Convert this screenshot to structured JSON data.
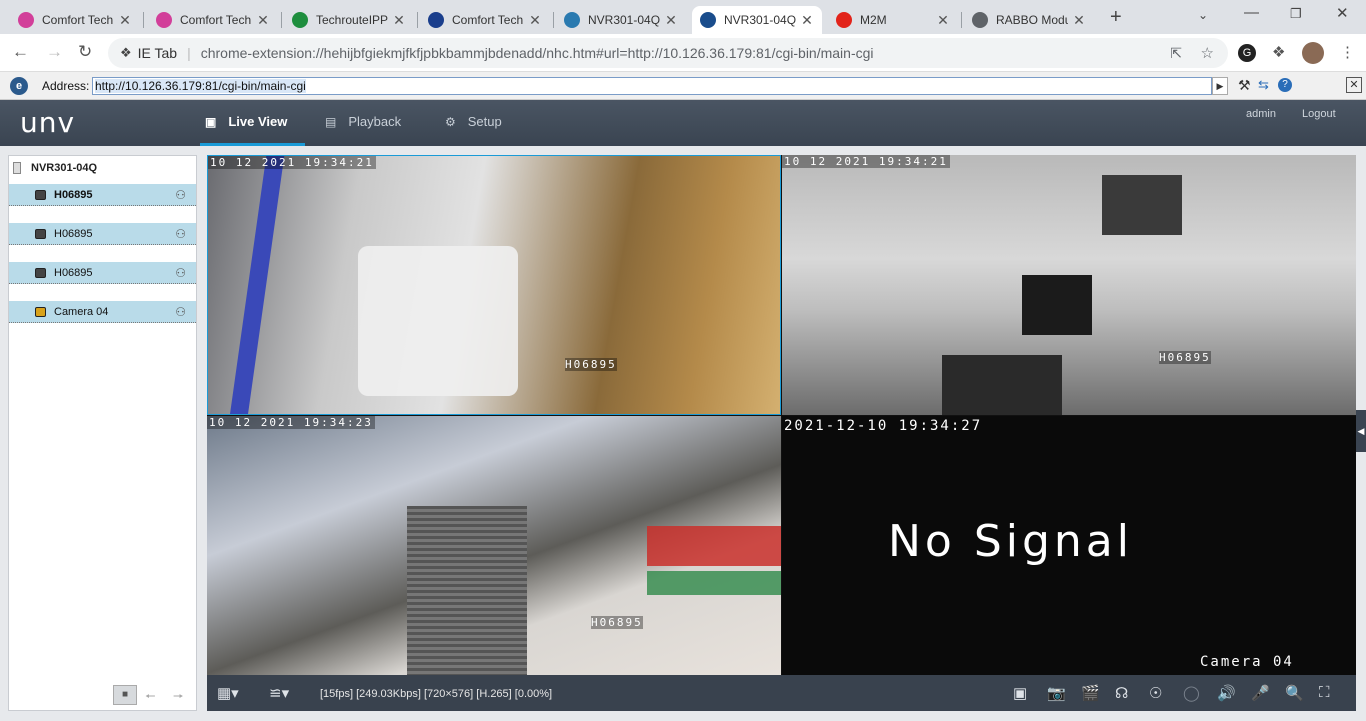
{
  "tabs": [
    {
      "title": "Comfort Tech",
      "icon": "comfort-tech-icon",
      "color": "#d23f9a"
    },
    {
      "title": "Comfort Tech",
      "icon": "comfort-tech-icon",
      "color": "#d23f9a"
    },
    {
      "title": "TechrouteIPP",
      "icon": "sheets-icon",
      "color": "#1e8e3e"
    },
    {
      "title": "Comfort Tech",
      "icon": "comfort-tech-logo-icon",
      "color": "#1a3e8c"
    },
    {
      "title": "NVR301-04Q",
      "icon": "nvr-icon",
      "color": "#2a7ab0"
    },
    {
      "title": "NVR301-04Q",
      "icon": "ie-tab-icon",
      "color": "#1a4d8c"
    },
    {
      "title": "M2M",
      "icon": "airtel-icon",
      "color": "#e2231a"
    },
    {
      "title": "RABBO Modu",
      "icon": "globe-icon",
      "color": "#5f6368"
    }
  ],
  "browser": {
    "ietab_label": "IE Tab",
    "url": "chrome-extension://hehijbfgiekmjfkfjpbkbammjbdenadd/nhc.htm#url=http://10.126.36.179:81/cgi-bin/main-cgi"
  },
  "iebar": {
    "address_label": "Address:",
    "address_value": "http://10.126.36.179:81/cgi-bin/main-cgi"
  },
  "app": {
    "logo": "unv",
    "nav": [
      {
        "label": "Live View",
        "icon": "monitor-icon"
      },
      {
        "label": "Playback",
        "icon": "film-icon"
      },
      {
        "label": "Setup",
        "icon": "gear-icon"
      }
    ],
    "user": "admin",
    "logout": "Logout"
  },
  "device": {
    "name": "NVR301-04Q",
    "cameras": [
      {
        "name": "H06895",
        "warn": false
      },
      {
        "name": "H06895",
        "warn": false
      },
      {
        "name": "H06895",
        "warn": false
      },
      {
        "name": "Camera 04",
        "warn": true
      }
    ]
  },
  "video": [
    {
      "ts": "10 12 2021  19:34:21",
      "label": "H06895"
    },
    {
      "ts": "10 12 2021  19:34:21",
      "label": "H06895"
    },
    {
      "ts": "10 12 2021  19:34:23",
      "label": "H06895"
    },
    {
      "ts": "2021-12-10  19:34:27",
      "label": "Camera 04",
      "center": "No  Signal"
    }
  ],
  "status": "[15fps] [249.03Kbps] [720×576] [H.265] [0.00%]",
  "colors": {
    "accent": "#1a9bd7",
    "nav_bg": "#3f4956",
    "selected_cam": "#b9dbe9"
  }
}
